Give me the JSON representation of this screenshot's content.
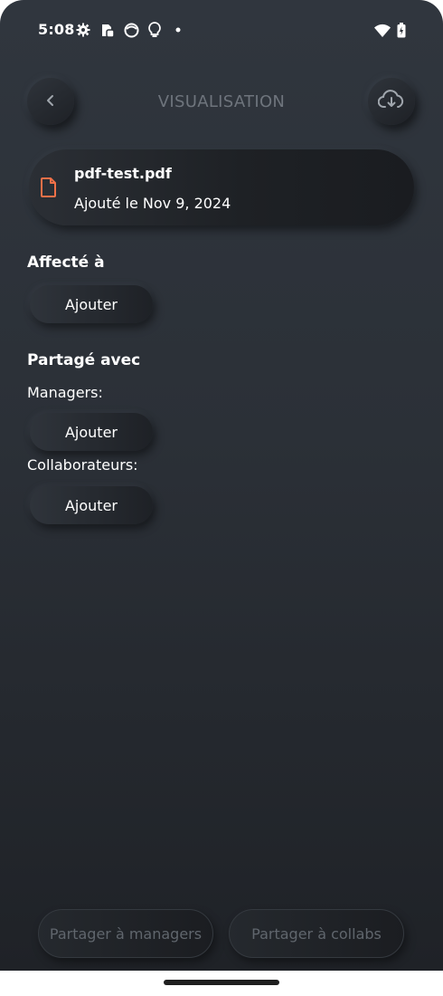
{
  "status_bar": {
    "time": "5:08",
    "icons": [
      "gear-icon",
      "sim-icon",
      "face-icon",
      "bulb-icon",
      "dot-icon",
      "wifi-icon",
      "battery-icon"
    ]
  },
  "header": {
    "title": "VISUALISATION",
    "back_icon": "chevron-left-icon",
    "download_icon": "cloud-download-icon"
  },
  "file": {
    "name": "pdf-test.pdf",
    "date": "Ajouté le Nov 9, 2024",
    "icon": "file-icon",
    "icon_color": "#f07048"
  },
  "assigned": {
    "title": "Affecté à",
    "add_label": "Ajouter"
  },
  "shared": {
    "title": "Partagé avec",
    "managers_label": "Managers:",
    "managers_add_label": "Ajouter",
    "collabs_label": "Collaborateurs:",
    "collabs_add_label": "Ajouter"
  },
  "footer": {
    "share_managers_label": "Partager à managers",
    "share_collabs_label": "Partager à collabs"
  }
}
